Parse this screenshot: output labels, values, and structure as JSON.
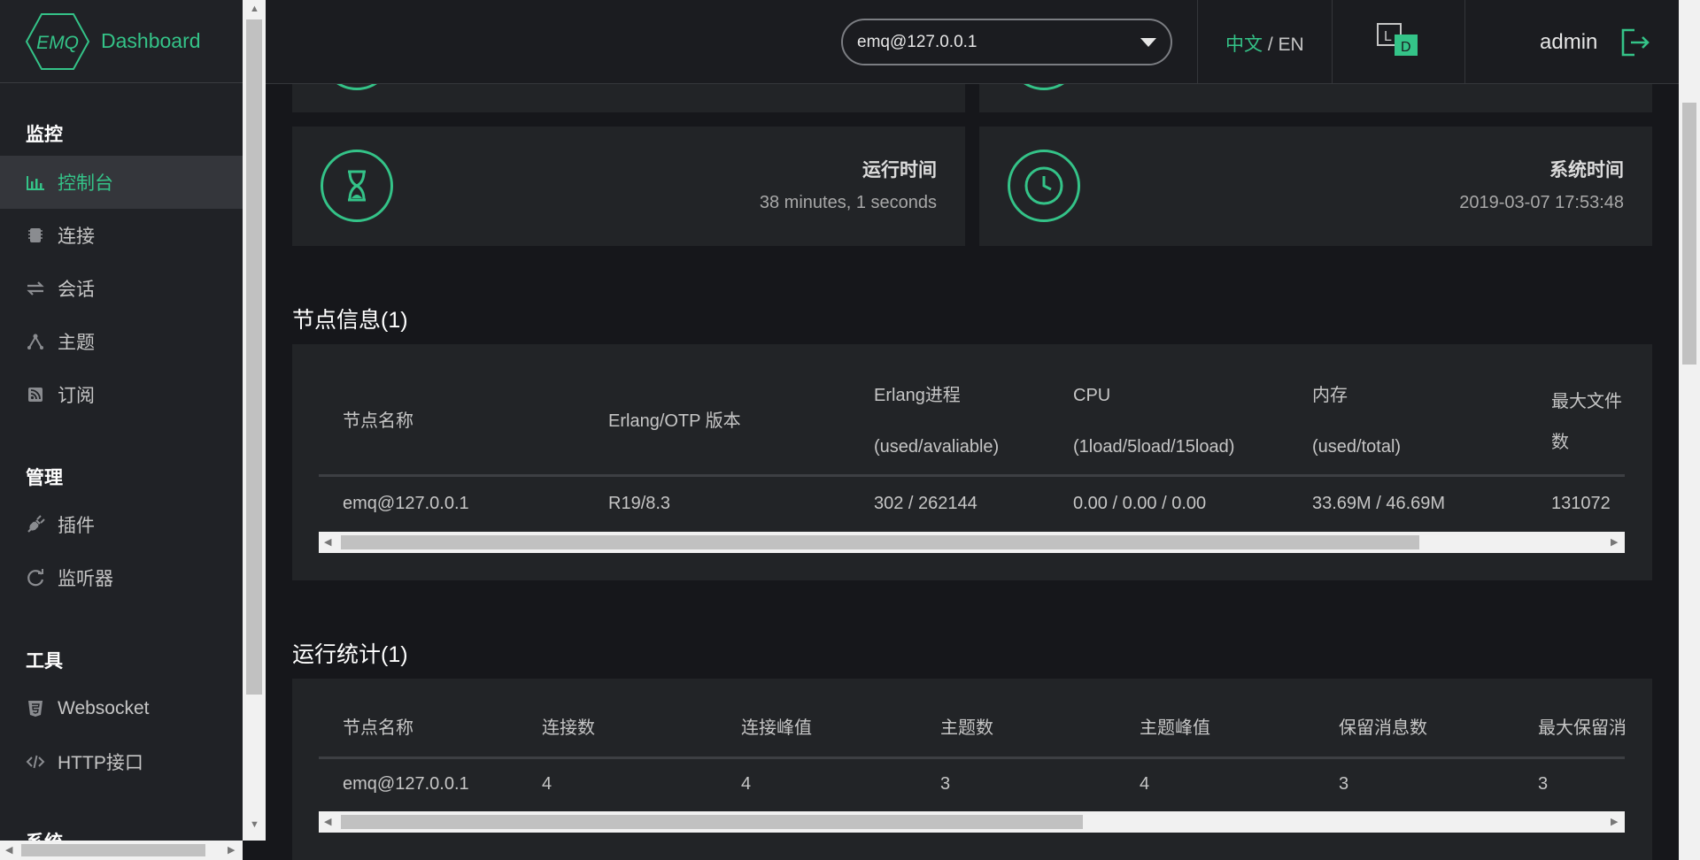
{
  "sidebar": {
    "brand_logo_text": "EMQ",
    "brand_title": "Dashboard",
    "groups": [
      {
        "title": "监控",
        "items": [
          {
            "label": "控制台",
            "icon": "bar-chart-icon",
            "active": true
          },
          {
            "label": "连接",
            "icon": "chip-icon"
          },
          {
            "label": "会话",
            "icon": "swap-arrows-icon"
          },
          {
            "label": "主题",
            "icon": "topic-branch-icon"
          },
          {
            "label": "订阅",
            "icon": "rss-icon"
          }
        ]
      },
      {
        "title": "管理",
        "items": [
          {
            "label": "插件",
            "icon": "plug-icon"
          },
          {
            "label": "监听器",
            "icon": "refresh-circle-icon"
          }
        ]
      },
      {
        "title": "工具",
        "items": [
          {
            "label": "Websocket",
            "icon": "html5-shield-icon"
          },
          {
            "label": "HTTP接口",
            "icon": "code-brackets-icon"
          }
        ]
      },
      {
        "title": "系统"
      }
    ]
  },
  "header": {
    "node_select_value": "emq@127.0.0.1",
    "lang_zh": "中文",
    "lang_sep": " / ",
    "lang_en": "EN",
    "theme_icon_letters": [
      "L",
      "D"
    ],
    "username": "admin"
  },
  "stats": {
    "uptime": {
      "title": "运行时间",
      "value": "38 minutes, 1 seconds"
    },
    "systime": {
      "title": "系统时间",
      "value": "2019-03-07 17:53:48"
    }
  },
  "node_info": {
    "title": "节点信息(1)",
    "headers": [
      [
        "节点名称"
      ],
      [
        "Erlang/OTP 版本"
      ],
      [
        "Erlang进程",
        "(used/avaliable)"
      ],
      [
        "CPU",
        "(1load/5load/15load)"
      ],
      [
        "内存",
        "(used/total)"
      ],
      [
        "最大文件",
        "数"
      ]
    ],
    "rows": [
      [
        "emq@127.0.0.1",
        "R19/8.3",
        "302 / 262144",
        "0.00 / 0.00 / 0.00",
        "33.69M / 46.69M",
        "131072"
      ]
    ]
  },
  "run_stats": {
    "title": "运行统计(1)",
    "headers": [
      "节点名称",
      "连接数",
      "连接峰值",
      "主题数",
      "主题峰值",
      "保留消息数",
      "最大保留消"
    ],
    "rows": [
      [
        "emq@127.0.0.1",
        "4",
        "4",
        "3",
        "4",
        "3",
        "3"
      ]
    ]
  },
  "colors": {
    "accent": "#34c388",
    "sidebar_bg": "#202226",
    "main_bg": "#16171b",
    "card_bg": "#222427"
  }
}
